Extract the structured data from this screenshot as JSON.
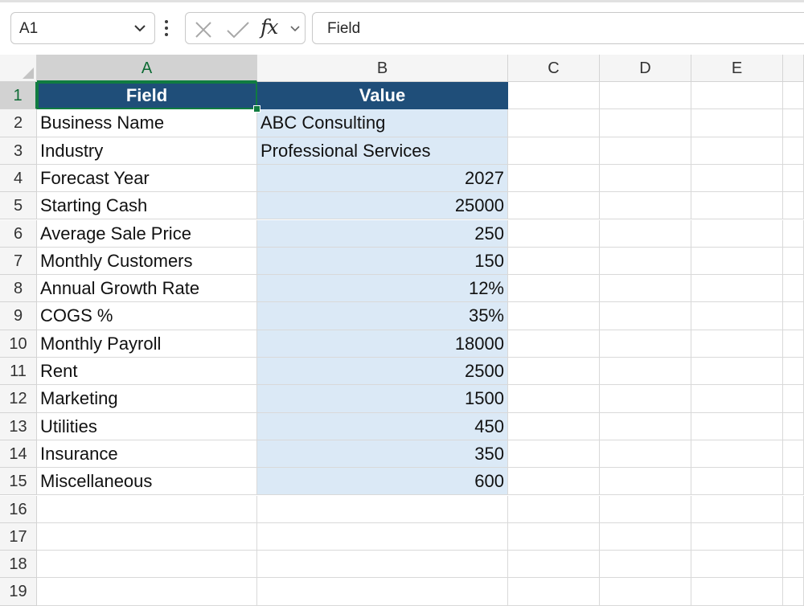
{
  "formula_bar": {
    "name_box": "A1",
    "fx_label": "fx",
    "formula": "Field"
  },
  "columns": [
    "A",
    "B",
    "C",
    "D",
    "E"
  ],
  "rows": [
    "1",
    "2",
    "3",
    "4",
    "5",
    "6",
    "7",
    "8",
    "9",
    "10",
    "11",
    "12",
    "13",
    "14",
    "15",
    "16",
    "17",
    "18",
    "19"
  ],
  "table": {
    "headers": [
      "Field",
      "Value"
    ],
    "rows": [
      [
        "Business Name",
        "ABC Consulting"
      ],
      [
        "Industry",
        "Professional Services"
      ],
      [
        "Forecast Year",
        "2027"
      ],
      [
        "Starting Cash",
        "25000"
      ],
      [
        "Average Sale Price",
        "250"
      ],
      [
        "Monthly Customers",
        "150"
      ],
      [
        "Annual Growth Rate",
        "12%"
      ],
      [
        "COGS %",
        "35%"
      ],
      [
        "Monthly Payroll",
        "18000"
      ],
      [
        "Rent",
        "2500"
      ],
      [
        "Marketing",
        "1500"
      ],
      [
        "Utilities",
        "450"
      ],
      [
        "Insurance",
        "350"
      ],
      [
        "Miscellaneous",
        "600"
      ]
    ]
  },
  "selected_cell": "A1",
  "colors": {
    "header_fill": "#1f4e79",
    "value_fill": "#dbe9f6",
    "selection": "#107c41"
  },
  "icons": [
    "chevron-down-icon",
    "more-options-icon",
    "cancel-icon",
    "enter-icon",
    "function-icon",
    "expand-icon"
  ]
}
